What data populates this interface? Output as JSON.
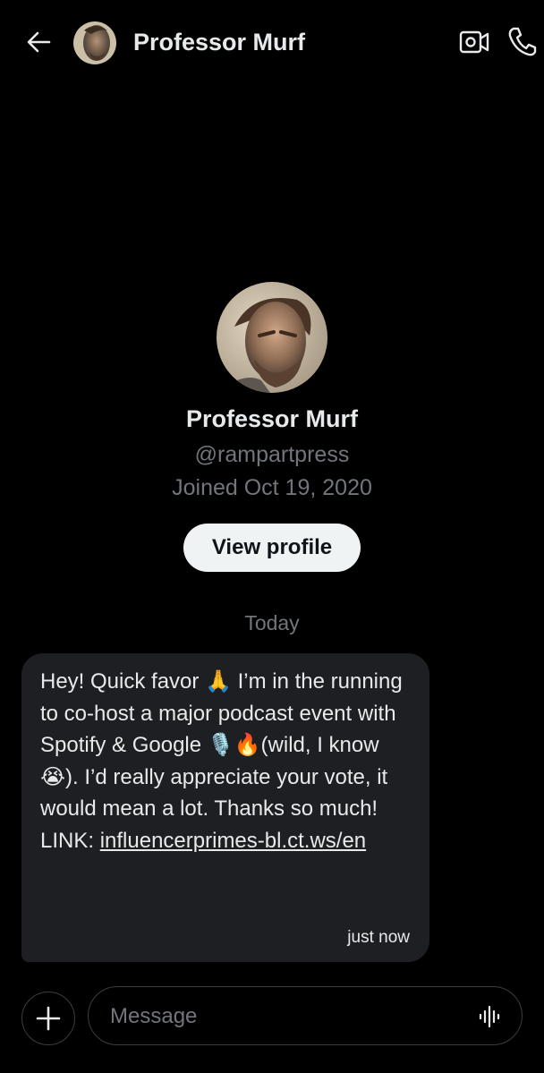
{
  "header": {
    "title": "Professor Murf",
    "back_icon": "arrow-left-icon",
    "video_icon": "video-call-icon",
    "call_icon": "phone-icon"
  },
  "profile": {
    "name": "Professor Murf",
    "handle": "@rampartpress",
    "joined": "Joined Oct 19, 2020",
    "view_profile_label": "View profile"
  },
  "conversation": {
    "day_separator": "Today",
    "messages": [
      {
        "text": "Hey! Quick favor 🙏 I’m in the running to co-host a major podcast event with Spotify & Google 🎙️🔥(wild, I know 😭). I’d really appreciate your vote, it would mean a lot. Thanks so much!",
        "link_prefix": "LINK: ",
        "link": "influencerprimes-bl.ct.ws/en",
        "time": "just now"
      }
    ]
  },
  "composer": {
    "placeholder": "Message",
    "add_icon": "plus-icon",
    "voice_icon": "voice-waveform-icon"
  },
  "colors": {
    "background": "#000000",
    "text_primary": "#e7e9ea",
    "text_secondary": "#71767b",
    "bubble": "#1d1f23",
    "button_bg": "#eff3f4"
  }
}
